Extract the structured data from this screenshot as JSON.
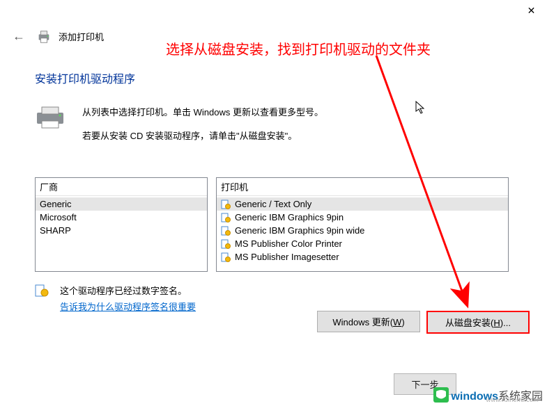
{
  "window": {
    "title": "添加打印机"
  },
  "header": {
    "section_title": "安装打印机驱动程序",
    "line1": "从列表中选择打印机。单击 Windows 更新以查看更多型号。",
    "line2": "若要从安装 CD 安装驱动程序，请单击\"从磁盘安装\"。"
  },
  "lists": {
    "manufacturers_header": "厂商",
    "manufacturers": [
      "Generic",
      "Microsoft",
      "SHARP"
    ],
    "manufacturers_selected": 0,
    "printers_header": "打印机",
    "printers": [
      "Generic / Text Only",
      "Generic IBM Graphics 9pin",
      "Generic IBM Graphics 9pin wide",
      "MS Publisher Color Printer",
      "MS Publisher Imagesetter"
    ],
    "printers_selected": 0
  },
  "signature": {
    "status": "这个驱动程序已经过数字签名。",
    "link": "告诉我为什么驱动程序签名很重要"
  },
  "buttons": {
    "windows_update": "Windows 更新(",
    "windows_update_key": "W",
    "windows_update_end": ")",
    "from_disk": "从磁盘安装(",
    "from_disk_key": "H",
    "from_disk_end": ")...",
    "next": "下一步"
  },
  "annotation": {
    "text": "选择从磁盘安装，找到打印机驱动的文件夹"
  },
  "watermark": {
    "brand_blue": "windows",
    "brand_rest": "系统家园",
    "sub": "www.ruiheifu.com"
  }
}
